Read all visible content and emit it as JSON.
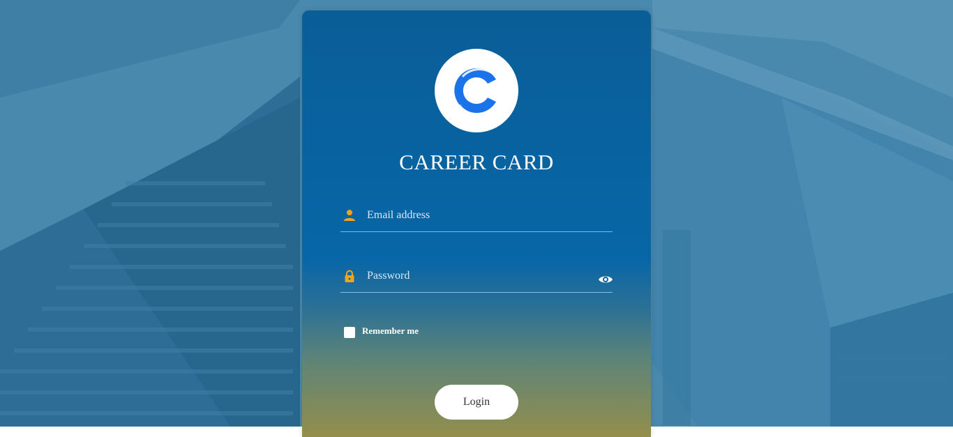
{
  "app": {
    "title": "CAREER CARD"
  },
  "login_form": {
    "email_placeholder": "Email address",
    "password_placeholder": "Password",
    "remember_label": "Remember me",
    "login_button": "Login"
  },
  "icons": {
    "logo": "c-logo-icon",
    "email": "user-icon",
    "password": "lock-icon",
    "toggle_password": "eye-icon"
  },
  "colors": {
    "accent_icon": "#f4a41c",
    "card_top": "#0a5e97",
    "card_bottom": "#948e4c",
    "logo_blue": "#1a73e8"
  }
}
